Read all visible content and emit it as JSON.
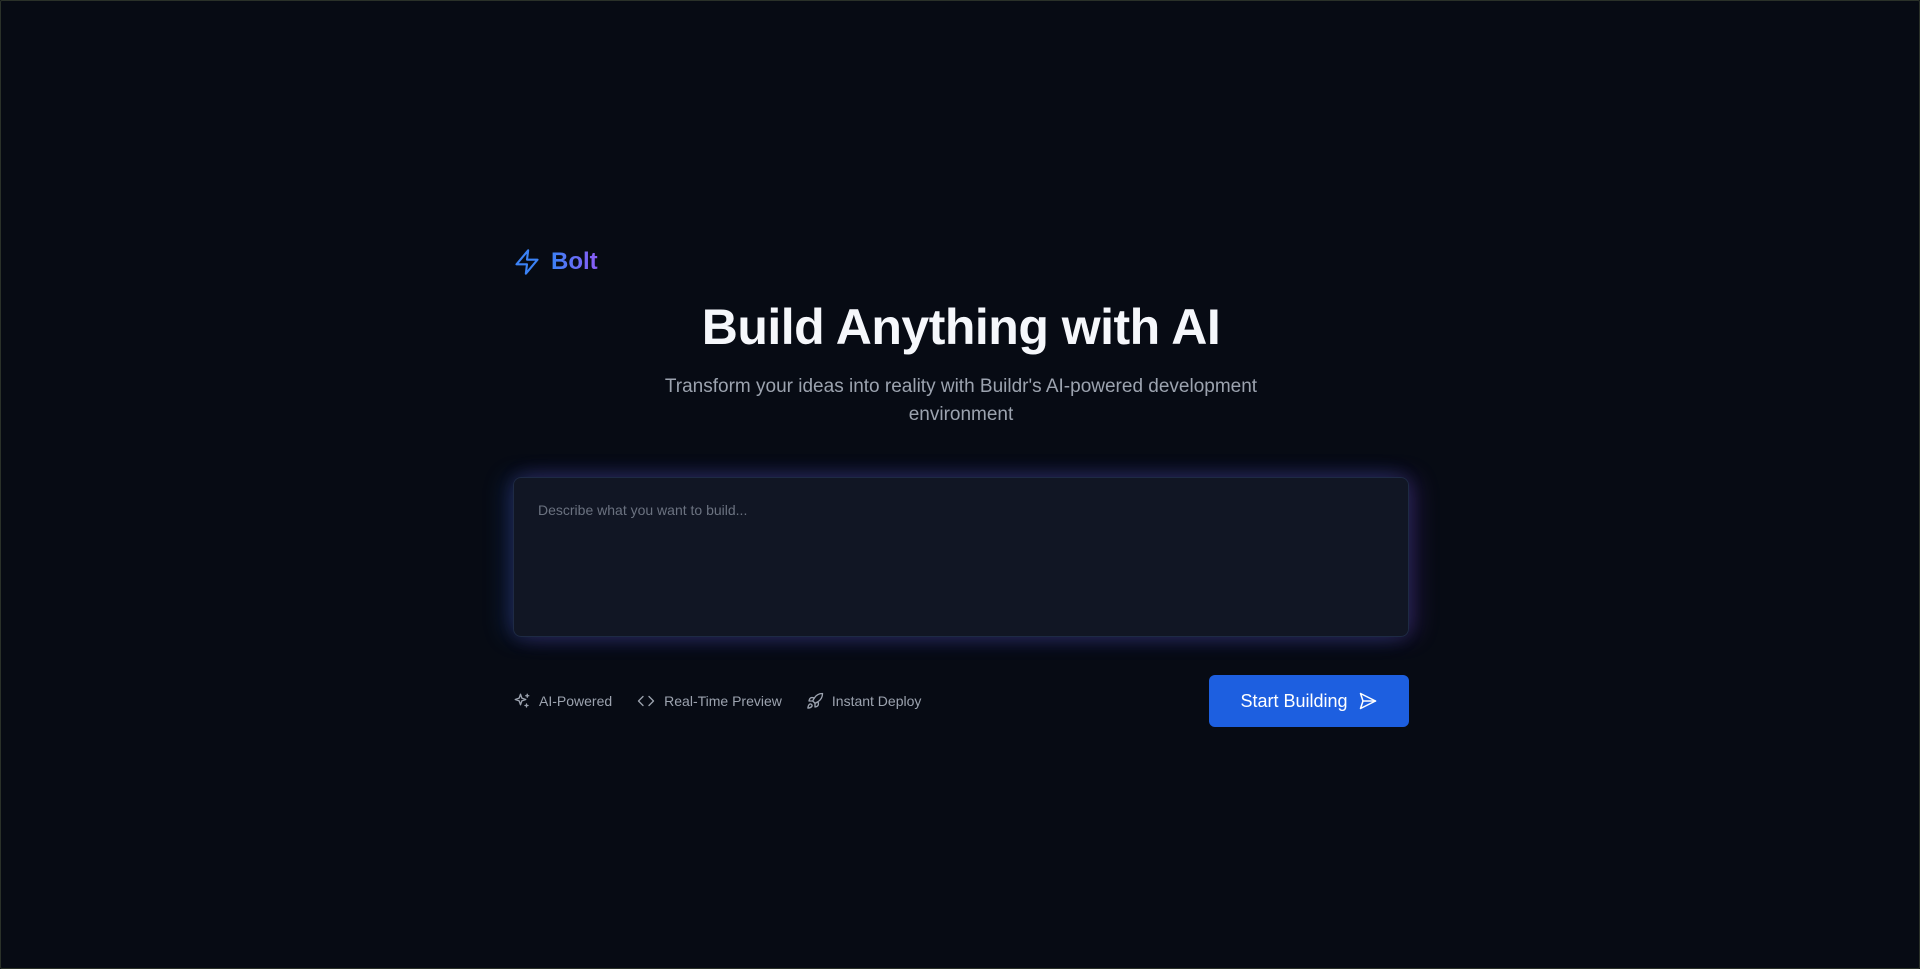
{
  "brand": {
    "name": "Bolt",
    "icon": "bolt-icon",
    "gradient": [
      "#3b82f6",
      "#8b5cf6"
    ]
  },
  "hero": {
    "title": "Build Anything with AI",
    "subtitle": "Transform your ideas into reality with Buildr's AI-powered development environment"
  },
  "prompt": {
    "placeholder": "Describe what you want to build...",
    "value": ""
  },
  "features": [
    {
      "label": "AI-Powered",
      "icon": "sparkles-icon"
    },
    {
      "label": "Real-Time Preview",
      "icon": "code-icon"
    },
    {
      "label": "Instant Deploy",
      "icon": "rocket-icon"
    }
  ],
  "actions": {
    "start_label": "Start Building",
    "start_icon": "send-icon"
  },
  "colors": {
    "background": "#070b14",
    "accent": "#1d5fe0",
    "muted_text": "#9ca3af"
  }
}
